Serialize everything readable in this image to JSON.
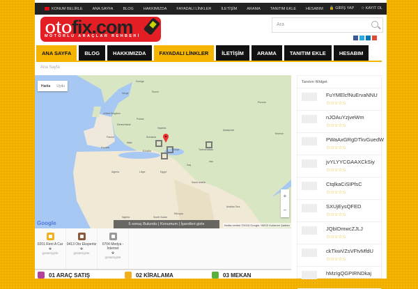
{
  "topbar": {
    "items": [
      "KONUM BELİRLE",
      "ANA SAYFA",
      "BLOG",
      "HAKKIMIZDA",
      "FAYADALI LİNKLER",
      "İLETİŞİM",
      "ARAMA",
      "TANITIM EKLE",
      "HESABIM"
    ],
    "login": "GİRİŞ YAP",
    "register": "KAYIT OL"
  },
  "logo": {
    "text": "otofix.com",
    "tagline": "MOTORLU ARAÇLAR REHBERİ"
  },
  "search": {
    "placeholder": "Ara"
  },
  "social": [
    "facebook",
    "twitter",
    "linkedin",
    "google-plus"
  ],
  "nav": [
    {
      "label": "ANA SAYFA",
      "active": true
    },
    {
      "label": "BLOG"
    },
    {
      "label": "HAKKIMIZDA"
    },
    {
      "label": "FAYADALI LİNKLER",
      "active": true
    },
    {
      "label": "İLETİŞİM"
    },
    {
      "label": "ARAMA"
    },
    {
      "label": "TANITIM EKLE"
    },
    {
      "label": "HESABIM"
    }
  ],
  "breadcrumb": "Ana Sayfa",
  "map": {
    "type_map": "Harita",
    "type_sat": "Uydu",
    "results": "5 sonuç Bulundu | Konumum | İşaretleri gizle",
    "attribution": "Harita verileri ©2015 Google, INEGI   Kullanım Şartları",
    "google": "Google",
    "zoom_in": "+",
    "zoom_out": "−",
    "labels": [
      "Sverige",
      "Suomi",
      "Norge",
      "United Kingdom",
      "Polska",
      "Deutschland",
      "France",
      "Україна",
      "România",
      "Italia",
      "España",
      "Ελλάδα",
      "Türkiye",
      "Қазақстан",
      "Россия",
      "Монгол",
      "Iraq",
      "Egypt",
      "Saudi Arabia",
      "Libya",
      "Algeria",
      "Nigeria",
      "South Sudan",
      "Ethiopia",
      "Arabian Sea",
      "Turkmenistan",
      "Iran"
    ]
  },
  "legend": [
    {
      "label": "0201 Rent A Car",
      "toggle": "göster/gizle",
      "color": "#f0b020"
    },
    {
      "label": "0413 Oto Ekspertiz",
      "toggle": "göster/gizle",
      "color": "#8b5a3c"
    },
    {
      "label": "0704 Medya - İnternet",
      "toggle": "göster/gizle",
      "color": "#999999"
    }
  ],
  "categories": [
    {
      "label": "01 ARAÇ SATIŞ",
      "color": "#b0449a"
    },
    {
      "label": "02 KİRALAMA",
      "color": "#f0b020"
    },
    {
      "label": "03 MEKAN",
      "color": "#5cb040"
    }
  ],
  "widget": {
    "title": "Tanıtım Widget",
    "rating": "☆☆☆☆☆",
    "items": [
      "FuYMElcfNuErvaNNU",
      "nJOAuYzjveWm",
      "PWaAxGRgDTkvGuedW",
      "jvYLYYCGAAXCkSiy",
      "CtqlkaCiSIPfsC",
      "SXUjEysQFED",
      "JQbIDmwcZJLJ",
      "ckTkwVZsVFtvMfdU",
      "hMzIgQGPIRNDkaj"
    ]
  }
}
